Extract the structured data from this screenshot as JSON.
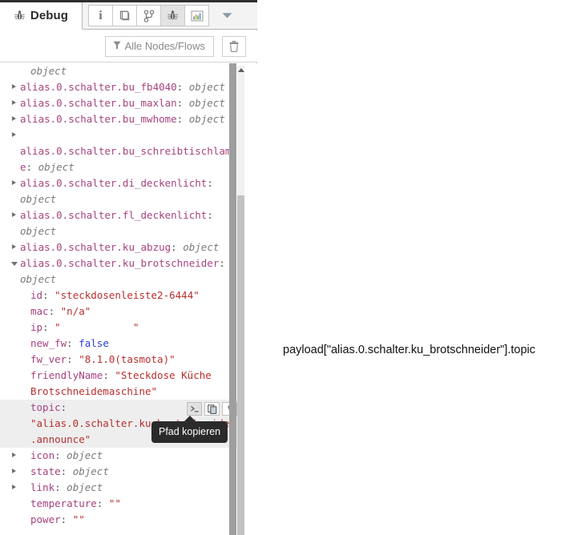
{
  "panel": {
    "tab": {
      "label": "Debug",
      "icon": "bug-icon"
    },
    "toolbar_buttons": [
      {
        "name": "info-icon",
        "glyph": "i",
        "selected": false
      },
      {
        "name": "library-icon",
        "glyph": "book",
        "selected": false
      },
      {
        "name": "flow-icon",
        "glyph": "branch",
        "selected": false
      },
      {
        "name": "debug-icon",
        "glyph": "bug",
        "selected": true
      },
      {
        "name": "dashboard-icon",
        "glyph": "chart",
        "selected": false
      }
    ],
    "toolbar_more": "chevron-down-icon",
    "filter": {
      "label": "Alle Nodes/Flows",
      "icon": "filter-icon",
      "clear_icon": "trash-icon"
    }
  },
  "tooltip": {
    "text": "Pfad kopieren"
  },
  "row_actions": [
    {
      "name": "send-to-console-icon",
      "selected": true
    },
    {
      "name": "copy-path-icon",
      "selected": false
    },
    {
      "name": "pin-path-icon",
      "selected": false
    }
  ],
  "annotation": {
    "text": "payload[\"alias.0.schalter.ku_brotschneider\"].topic"
  },
  "colors": {
    "key": "#a6437e",
    "type": "#7a7a7a",
    "string": "#b82e2e",
    "boolean": "#2640d6",
    "highlight_row": "#eeeeee",
    "tooltip_bg": "#2b2b2b"
  },
  "tree": [
    {
      "id": "r0",
      "indent": 1,
      "caret": "none",
      "parts": [
        {
          "cls": "t",
          "text": "object"
        }
      ]
    },
    {
      "id": "r1",
      "indent": 0,
      "caret": "closed",
      "parts": [
        {
          "cls": "k",
          "text": "alias.0.schalter.bu_fb4040"
        },
        {
          "cls": "plain",
          "text": ": "
        },
        {
          "cls": "t",
          "text": "object"
        }
      ]
    },
    {
      "id": "r2",
      "indent": 0,
      "caret": "closed",
      "parts": [
        {
          "cls": "k",
          "text": "alias.0.schalter.bu_maxlan"
        },
        {
          "cls": "plain",
          "text": ": "
        },
        {
          "cls": "t",
          "text": "object"
        }
      ]
    },
    {
      "id": "r3",
      "indent": 0,
      "caret": "closed",
      "parts": [
        {
          "cls": "k",
          "text": "alias.0.schalter.bu_mwhome"
        },
        {
          "cls": "plain",
          "text": ": "
        },
        {
          "cls": "t",
          "text": "object"
        }
      ]
    },
    {
      "id": "r4",
      "indent": 0,
      "caret": "closed",
      "parts": [
        {
          "cls": "k",
          "text": "\nalias.0.schalter.bu_schreibtischlampe"
        },
        {
          "cls": "plain",
          "text": ": "
        },
        {
          "cls": "t",
          "text": "object"
        }
      ]
    },
    {
      "id": "r5",
      "indent": 0,
      "caret": "closed",
      "parts": [
        {
          "cls": "k",
          "text": "alias.0.schalter.di_deckenlicht"
        },
        {
          "cls": "plain",
          "text": ": "
        },
        {
          "cls": "t",
          "text": "object"
        }
      ]
    },
    {
      "id": "r6",
      "indent": 0,
      "caret": "closed",
      "parts": [
        {
          "cls": "k",
          "text": "alias.0.schalter.fl_deckenlicht"
        },
        {
          "cls": "plain",
          "text": ": "
        },
        {
          "cls": "t",
          "text": "object"
        }
      ]
    },
    {
      "id": "r7",
      "indent": 0,
      "caret": "closed",
      "parts": [
        {
          "cls": "k",
          "text": "alias.0.schalter.ku_abzug"
        },
        {
          "cls": "plain",
          "text": ": "
        },
        {
          "cls": "t",
          "text": "object"
        }
      ]
    },
    {
      "id": "r8",
      "indent": 0,
      "caret": "open",
      "parts": [
        {
          "cls": "k",
          "text": "alias.0.schalter.ku_brotschneider"
        },
        {
          "cls": "plain",
          "text": ": "
        },
        {
          "cls": "t",
          "text": "object"
        }
      ]
    },
    {
      "id": "r9",
      "indent": 1,
      "caret": "none",
      "parts": [
        {
          "cls": "k",
          "text": "id"
        },
        {
          "cls": "plain",
          "text": ": "
        },
        {
          "cls": "s",
          "text": "\"steckdosenleiste2-6444\""
        }
      ]
    },
    {
      "id": "r10",
      "indent": 1,
      "caret": "none",
      "parts": [
        {
          "cls": "k",
          "text": "mac"
        },
        {
          "cls": "plain",
          "text": ": "
        },
        {
          "cls": "s",
          "text": "\"n/a\""
        }
      ]
    },
    {
      "id": "r11",
      "indent": 1,
      "caret": "none",
      "parts": [
        {
          "cls": "k",
          "text": "ip"
        },
        {
          "cls": "plain",
          "text": ": "
        },
        {
          "cls": "s",
          "text": "\"            \""
        }
      ]
    },
    {
      "id": "r12",
      "indent": 1,
      "caret": "none",
      "parts": [
        {
          "cls": "k",
          "text": "new_fw"
        },
        {
          "cls": "plain",
          "text": ": "
        },
        {
          "cls": "b",
          "text": "false"
        }
      ]
    },
    {
      "id": "r13",
      "indent": 1,
      "caret": "none",
      "parts": [
        {
          "cls": "k",
          "text": "fw_ver"
        },
        {
          "cls": "plain",
          "text": ": "
        },
        {
          "cls": "s",
          "text": "\"8.1.0(tasmota)\""
        }
      ]
    },
    {
      "id": "r14",
      "indent": 1,
      "caret": "none",
      "parts": [
        {
          "cls": "k",
          "text": "friendlyName"
        },
        {
          "cls": "plain",
          "text": ": "
        },
        {
          "cls": "s",
          "text": "\"Steckdose Küche Brotschneidemaschine\""
        }
      ]
    },
    {
      "id": "r15",
      "indent": 1,
      "caret": "none",
      "highlight": true,
      "actions": true,
      "parts": [
        {
          "cls": "k",
          "text": "topic"
        },
        {
          "cls": "plain",
          "text": ": "
        },
        {
          "cls": "s",
          "text": "\"alias.0.schalter.ku_brotschneider.announce\""
        }
      ]
    },
    {
      "id": "r16",
      "indent": 1,
      "caret": "closed",
      "parts": [
        {
          "cls": "k",
          "text": "icon"
        },
        {
          "cls": "plain",
          "text": ": "
        },
        {
          "cls": "t",
          "text": "object"
        }
      ]
    },
    {
      "id": "r17",
      "indent": 1,
      "caret": "closed",
      "parts": [
        {
          "cls": "k",
          "text": "state"
        },
        {
          "cls": "plain",
          "text": ": "
        },
        {
          "cls": "t",
          "text": "object"
        }
      ]
    },
    {
      "id": "r18",
      "indent": 1,
      "caret": "closed",
      "parts": [
        {
          "cls": "k",
          "text": "link"
        },
        {
          "cls": "plain",
          "text": ": "
        },
        {
          "cls": "t",
          "text": "object"
        }
      ]
    },
    {
      "id": "r19",
      "indent": 1,
      "caret": "none",
      "parts": [
        {
          "cls": "k",
          "text": "temperature"
        },
        {
          "cls": "plain",
          "text": ": "
        },
        {
          "cls": "s",
          "text": "\"\""
        }
      ]
    },
    {
      "id": "r20",
      "indent": 1,
      "caret": "none",
      "parts": [
        {
          "cls": "k",
          "text": "power"
        },
        {
          "cls": "plain",
          "text": ": "
        },
        {
          "cls": "s",
          "text": "\"\""
        }
      ]
    }
  ]
}
